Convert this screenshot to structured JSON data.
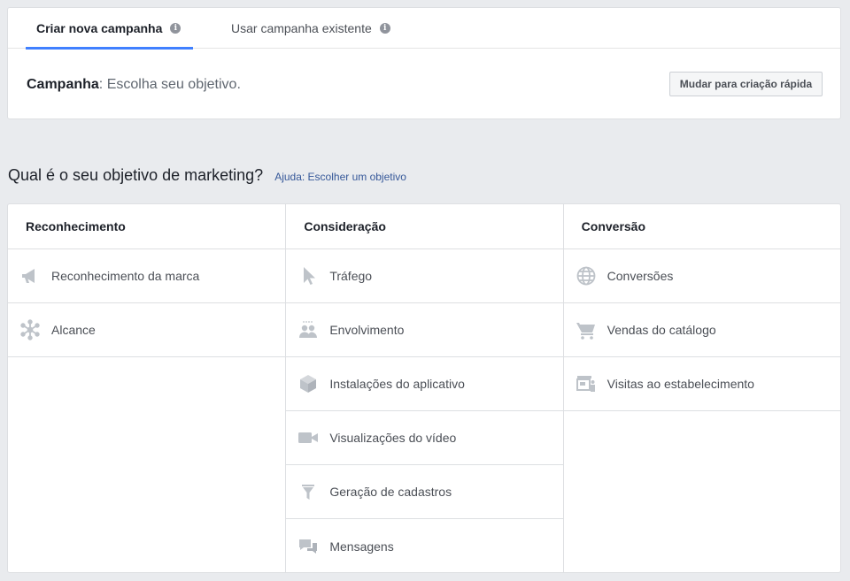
{
  "tabs": [
    {
      "label": "Criar nova campanha",
      "active": true,
      "info_icon": "info-icon"
    },
    {
      "label": "Usar campanha existente",
      "active": false,
      "info_icon": "info-icon"
    }
  ],
  "campaign": {
    "label": "Campanha",
    "text": ": Escolha seu objetivo.",
    "quick_button": "Mudar para criação rápida"
  },
  "objective": {
    "question": "Qual é o seu objetivo de marketing?",
    "help_link": "Ajuda: Escolher um objetivo"
  },
  "colors": {
    "accent": "#4080ff",
    "link": "#365899",
    "icon": "#bec3c9"
  },
  "columns": [
    {
      "title": "Reconhecimento",
      "items": [
        {
          "label": "Reconhecimento da marca",
          "icon": "megaphone-icon"
        },
        {
          "label": "Alcance",
          "icon": "reach-icon"
        }
      ]
    },
    {
      "title": "Consideração",
      "items": [
        {
          "label": "Tráfego",
          "icon": "cursor-icon"
        },
        {
          "label": "Envolvimento",
          "icon": "people-icon"
        },
        {
          "label": "Instalações do aplicativo",
          "icon": "box-icon"
        },
        {
          "label": "Visualizações do vídeo",
          "icon": "video-camera-icon"
        },
        {
          "label": "Geração de cadastros",
          "icon": "funnel-icon"
        },
        {
          "label": "Mensagens",
          "icon": "chat-bubbles-icon"
        }
      ]
    },
    {
      "title": "Conversão",
      "items": [
        {
          "label": "Conversões",
          "icon": "globe-icon"
        },
        {
          "label": "Vendas do catálogo",
          "icon": "shopping-cart-icon"
        },
        {
          "label": "Visitas ao estabelecimento",
          "icon": "store-icon"
        }
      ]
    }
  ]
}
